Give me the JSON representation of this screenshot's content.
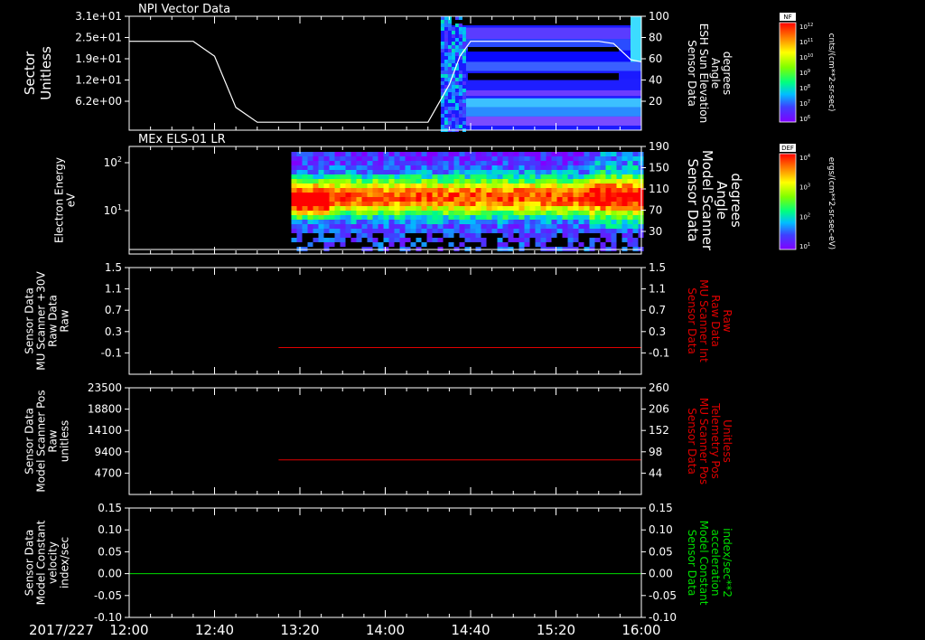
{
  "date_label": "2017/227",
  "time_axis": {
    "start_min": 720,
    "end_min": 960,
    "tick_labels": [
      "12:00",
      "12:40",
      "13:20",
      "14:00",
      "14:40",
      "15:20",
      "16:00"
    ],
    "tick_values_min": [
      720,
      760,
      800,
      840,
      880,
      920,
      960
    ]
  },
  "colors": {
    "background": "#000000",
    "axis": "#ffffff",
    "red_trace": "#e00000",
    "green_trace": "#00dd00"
  },
  "chart_data": [
    {
      "id": "panel1",
      "type": "heatmap",
      "title": "NPI Vector Data",
      "ylabel_left": [
        "Sector",
        "Unitless"
      ],
      "left_ticks": [
        "3.1e+01",
        "2.5e+01",
        "1.9e+01",
        "1.2e+01",
        "6.2e+00"
      ],
      "ylabel_right": [
        "Sensor Data",
        "ESH Sun Elevation",
        "Angle",
        "degrees"
      ],
      "right_ticks": [
        "100",
        "80",
        "60",
        "40",
        "20"
      ],
      "right_ylim": [
        0,
        100
      ],
      "colorbar": {
        "label": "NF",
        "units": "cnts/(cm**2-sr-sec)",
        "ticks": [
          "10^12",
          "10^11",
          "10^10",
          "10^9",
          "10^8",
          "10^7",
          "10^6"
        ]
      },
      "line_series": {
        "name": "ESH Sun Elevation Angle",
        "x": [
          720,
          750,
          760,
          770,
          780,
          800,
          820,
          840,
          850,
          860,
          870,
          875,
          880,
          900,
          920,
          940,
          947,
          955,
          960
        ],
        "y": [
          78,
          78,
          65,
          20,
          7,
          7,
          7,
          7,
          7,
          7,
          40,
          65,
          78,
          78,
          78,
          78,
          76,
          62,
          60
        ]
      },
      "data_start_min": 866
    },
    {
      "id": "panel2",
      "type": "heatmap",
      "title": "MEx ELS-01 LR",
      "ylabel_left": [
        "Electron Energy",
        "eV"
      ],
      "left_ticks": [
        "10^2",
        "10^1"
      ],
      "ylabel_right": [
        "Sensor Data",
        "Model Scanner",
        "Angle",
        "degrees"
      ],
      "right_ticks": [
        "190",
        "150",
        "110",
        "70",
        "30"
      ],
      "right_ylim": [
        0,
        190
      ],
      "colorbar": {
        "label": "DEF",
        "units": "ergs/(cm**2-sr-sec-eV)",
        "ticks": [
          "10^4",
          "10^3",
          "10^2",
          "10^1"
        ]
      },
      "line_series": {
        "name": "Model Scanner Angle",
        "x": [
          720,
          960
        ],
        "y": [
          8,
          8
        ]
      },
      "data_start_min": 796
    },
    {
      "id": "panel3",
      "type": "line",
      "ylabel_left": [
        "Sensor Data",
        "MU Scanner +30V",
        "Raw Data",
        "Raw"
      ],
      "left_ticks": [
        "1.5",
        "1.1",
        "0.7",
        "0.3",
        "-0.1"
      ],
      "ylabel_right": [
        "Sensor Data",
        "MU Scanner Int",
        "Raw Data",
        "Raw"
      ],
      "right_ticks": [
        "1.5",
        "1.1",
        "0.7",
        "0.3",
        "-0.1"
      ],
      "ylim": [
        -0.5,
        1.5
      ],
      "series": [
        {
          "x": [
            790,
            960
          ],
          "y": [
            0.0,
            0.0
          ]
        }
      ]
    },
    {
      "id": "panel4",
      "type": "line",
      "ylabel_left": [
        "Sensor Data",
        "Model Scanner Pos",
        "Raw",
        "unitless"
      ],
      "left_ticks": [
        "23500",
        "18800",
        "14100",
        "9400",
        "4700"
      ],
      "ylabel_right": [
        "Sensor Data",
        "MU Scanner Pos",
        "Telemetry Pos",
        "Unitless"
      ],
      "right_ticks": [
        "260",
        "206",
        "152",
        "98",
        "44"
      ],
      "ylim": [
        0,
        23500
      ],
      "right_ylim": [
        0,
        260
      ],
      "series": [
        {
          "x": [
            790,
            960
          ],
          "y": [
            7600,
            7600
          ]
        }
      ]
    },
    {
      "id": "panel5",
      "type": "line",
      "ylabel_left": [
        "Sensor Data",
        "Model Constant",
        "velocity",
        "index/sec"
      ],
      "left_ticks": [
        "0.15",
        "0.10",
        "0.05",
        "0.00",
        "-0.05",
        "-0.10"
      ],
      "ylabel_right": [
        "Sensor Data",
        "Model Constant",
        "acceleration",
        "index/sec**2"
      ],
      "right_ticks": [
        "0.15",
        "0.10",
        "0.05",
        "0.00",
        "-0.05",
        "-0.10"
      ],
      "ylim": [
        -0.1,
        0.15
      ],
      "series": [
        {
          "x": [
            720,
            960
          ],
          "y": [
            0.0,
            0.0
          ]
        }
      ]
    }
  ]
}
